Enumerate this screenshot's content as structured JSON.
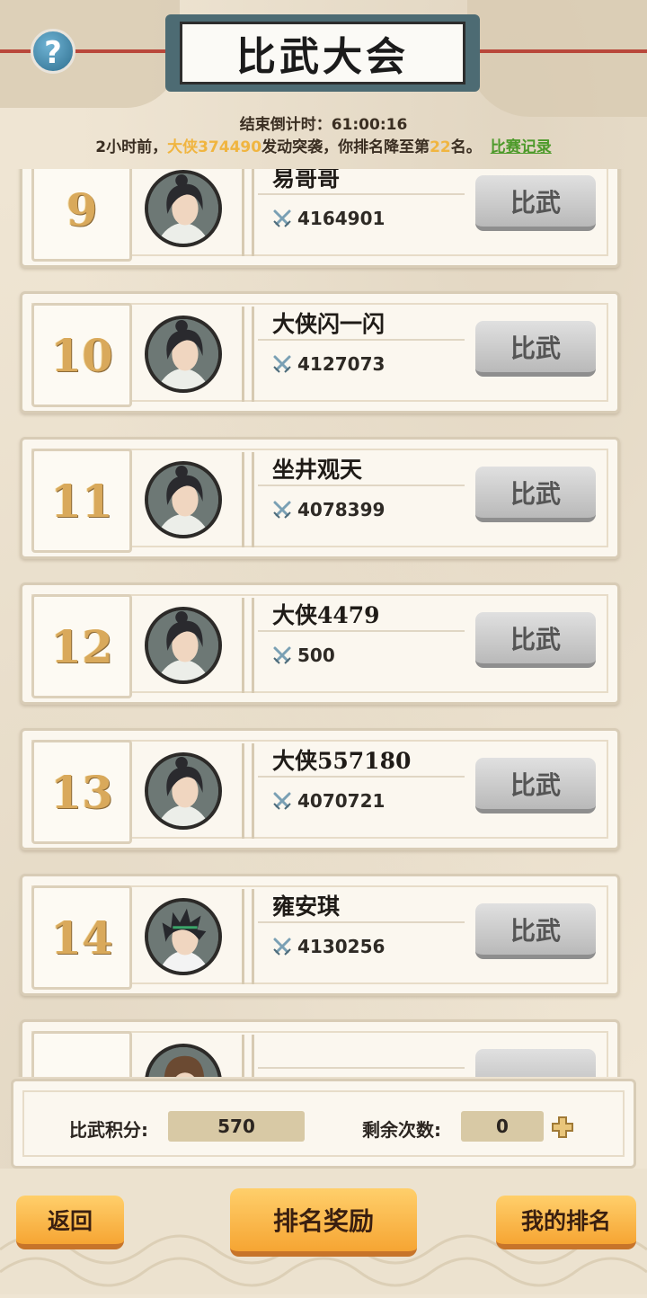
{
  "header": {
    "title": "比武大会",
    "help_icon": "question-icon"
  },
  "countdown": "结束倒计时：61:00:16",
  "notice": {
    "prefix": "2小时前，",
    "attacker": "大侠374490",
    "mid": "发动突袭，你排名降至第",
    "rank": "22",
    "suffix": "名。",
    "record_link": "比赛记录"
  },
  "rows": [
    {
      "rank": "9",
      "name": "易哥哥",
      "power": "4164901",
      "avatar": "male-topknot",
      "button": "比武"
    },
    {
      "rank": "10",
      "name": "大侠闪一闪",
      "power": "4127073",
      "avatar": "male-topknot",
      "button": "比武"
    },
    {
      "rank": "11",
      "name": "坐井观天",
      "power": "4078399",
      "avatar": "male-topknot",
      "button": "比武"
    },
    {
      "rank": "12",
      "name": "大侠4479",
      "power": "500",
      "avatar": "male-topknot",
      "button": "比武"
    },
    {
      "rank": "13",
      "name": "大侠557180",
      "power": "4070721",
      "avatar": "male-topknot",
      "button": "比武"
    },
    {
      "rank": "14",
      "name": "雍安琪",
      "power": "4130256",
      "avatar": "male-spiky",
      "button": "比武"
    },
    {
      "rank": "",
      "name": "",
      "power": "",
      "avatar": "male-brown",
      "button": ""
    }
  ],
  "status": {
    "score_label": "比武积分:",
    "score": "570",
    "remain_label": "剩余次数:",
    "remain": "0"
  },
  "buttons": {
    "back": "返回",
    "reward": "排名奖励",
    "my_rank": "我的排名"
  },
  "colors": {
    "highlight": "#f0b540",
    "link": "#4d9a2a",
    "orange_button": "#f6a533",
    "rank_gold": "#d9a95b"
  }
}
